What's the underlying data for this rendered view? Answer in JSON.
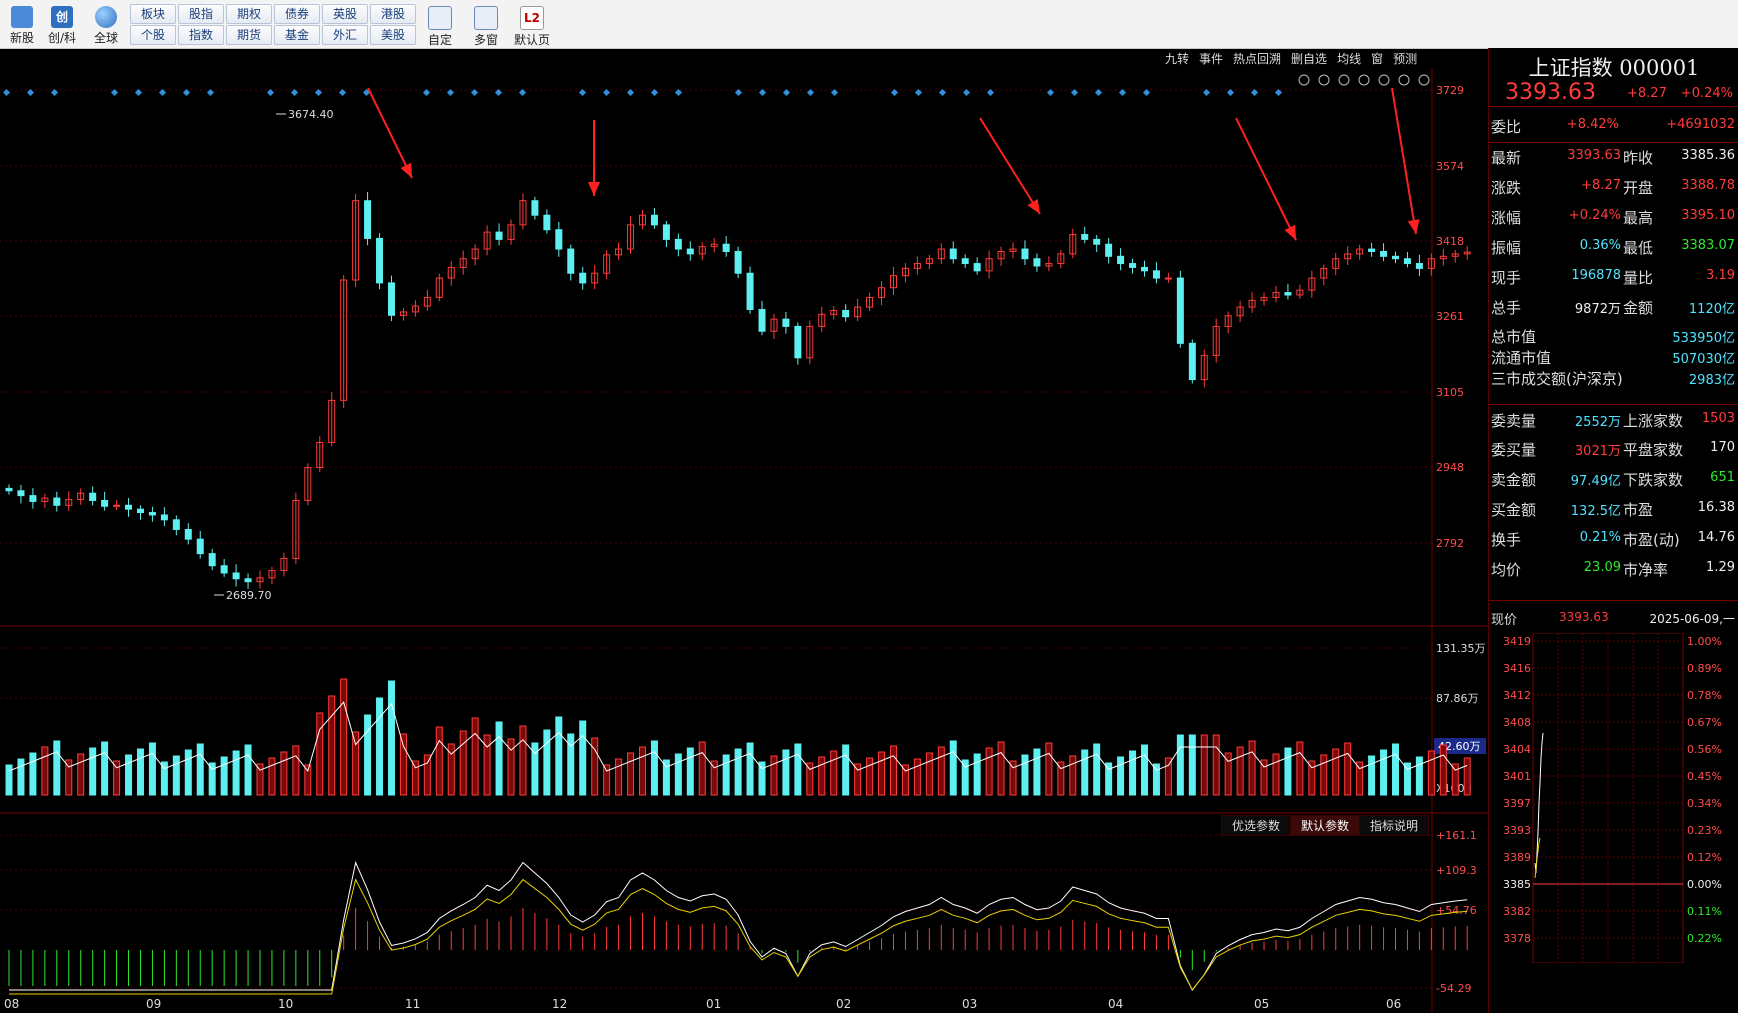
{
  "toolbar": {
    "big": [
      {
        "label": "新股",
        "icon": "doc-icon"
      },
      {
        "label": "创/科",
        "icon": "chuang-icon",
        "glyph": "创"
      },
      {
        "label": "全球",
        "icon": "globe-icon"
      },
      {
        "label": "自定",
        "icon": "custom-icon"
      },
      {
        "label": "多窗",
        "icon": "multiwindow-icon"
      },
      {
        "label": "默认页",
        "icon": "l2-icon",
        "glyph": "L2"
      }
    ],
    "grid": [
      [
        "板块",
        "股指",
        "期权",
        "债券",
        "英股",
        "港股"
      ],
      [
        "个股",
        "指数",
        "期货",
        "基金",
        "外汇",
        "美股"
      ]
    ]
  },
  "topbar": [
    "九转",
    "事件",
    "热点回溯",
    "删自选",
    "均线",
    "窗",
    "预测"
  ],
  "chart": {
    "annotations": [
      "3674.40",
      "2689.70"
    ],
    "price_axis": [
      "3729",
      "3574",
      "3418",
      "3261",
      "3105",
      "2948",
      "2792"
    ],
    "vol_axis": [
      "131.35万",
      "87.86万"
    ],
    "vol_current": "42.60万",
    "vol_unit": "X1000",
    "macd_axis": [
      "+161.1",
      "+109.3",
      "+54.76",
      "-54.29"
    ],
    "macd_tabs": [
      "优选参数",
      "默认参数",
      "指标说明"
    ],
    "months": [
      "08",
      "09",
      "10",
      "11",
      "12",
      "01",
      "02",
      "03",
      "04",
      "05",
      "06"
    ]
  },
  "chart_data": {
    "type": "candlestick",
    "ylim": [
      2600,
      3760
    ],
    "high_label": "3674.40",
    "low_label": "2689.70",
    "months": [
      "08",
      "09",
      "10",
      "11",
      "12",
      "01",
      "02",
      "03",
      "04",
      "05",
      "06"
    ],
    "close_series": [
      2900,
      2890,
      2878,
      2885,
      2870,
      2882,
      2895,
      2880,
      2868,
      2870,
      2862,
      2855,
      2850,
      2840,
      2820,
      2800,
      2770,
      2745,
      2730,
      2718,
      2712,
      2720,
      2735,
      2760,
      2880,
      2948,
      3000,
      3087,
      3336,
      3500,
      3422,
      3330,
      3263,
      3270,
      3282,
      3300,
      3340,
      3362,
      3380,
      3400,
      3435,
      3420,
      3450,
      3500,
      3470,
      3440,
      3400,
      3350,
      3330,
      3350,
      3388,
      3400,
      3450,
      3470,
      3450,
      3420,
      3400,
      3390,
      3405,
      3410,
      3395,
      3350,
      3275,
      3230,
      3255,
      3240,
      3175,
      3240,
      3265,
      3273,
      3260,
      3280,
      3300,
      3320,
      3345,
      3360,
      3370,
      3380,
      3400,
      3380,
      3370,
      3355,
      3380,
      3395,
      3400,
      3380,
      3365,
      3370,
      3390,
      3430,
      3420,
      3410,
      3385,
      3370,
      3362,
      3355,
      3340,
      3340,
      3205,
      3130,
      3180,
      3240,
      3262,
      3280,
      3294,
      3300,
      3310,
      3305,
      3315,
      3340,
      3360,
      3380,
      3390,
      3400,
      3395,
      3385,
      3380,
      3370,
      3360,
      3380,
      3385,
      3390,
      3393.63
    ],
    "macd_axis": [
      "+161.1",
      "+109.3",
      "+54.76",
      "-54.29"
    ]
  },
  "quote": {
    "title": "上证指数 000001",
    "price": "3393.63",
    "change": "+8.27",
    "change_pct": "+0.24%",
    "weibi_label": "委比",
    "weibi": "+8.42%",
    "weibi_diff": "+4691032",
    "rows": [
      {
        "l1": "最新",
        "v1": "3393.63",
        "c1": "red",
        "l2": "昨收",
        "v2": "3385.36",
        "c2": "wht"
      },
      {
        "l1": "涨跌",
        "v1": "+8.27",
        "c1": "red",
        "l2": "开盘",
        "v2": "3388.78",
        "c2": "red"
      },
      {
        "l1": "涨幅",
        "v1": "+0.24%",
        "c1": "red",
        "l2": "最高",
        "v2": "3395.10",
        "c2": "red"
      },
      {
        "l1": "振幅",
        "v1": "0.36%",
        "c1": "cyan",
        "l2": "最低",
        "v2": "3383.07",
        "c2": "grn"
      },
      {
        "l1": "现手",
        "v1": "196878",
        "c1": "cyan",
        "l2": "量比",
        "v2": "3.19",
        "c2": "red"
      },
      {
        "l1": "总手",
        "v1": "9872万",
        "c1": "wht",
        "l2": "金额",
        "v2": "1120亿",
        "c2": "cyan"
      }
    ],
    "mkt": [
      {
        "l": "总市值",
        "v": "533950亿"
      },
      {
        "l": "流通市值",
        "v": "507030亿"
      },
      {
        "l": "三市成交额(沪深京)",
        "v": "2983亿"
      }
    ],
    "rows2": [
      {
        "l1": "委卖量",
        "v1": "2552万",
        "c1": "cyan",
        "l2": "上涨家数",
        "v2": "1503",
        "c2": "red"
      },
      {
        "l1": "委买量",
        "v1": "3021万",
        "c1": "red",
        "l2": "平盘家数",
        "v2": "170",
        "c2": "wht"
      },
      {
        "l1": "卖金额",
        "v1": "97.49亿",
        "c1": "cyan",
        "l2": "下跌家数",
        "v2": "651",
        "c2": "grn"
      },
      {
        "l1": "买金额",
        "v1": "132.5亿",
        "c1": "cyan",
        "l2": "市盈",
        "v2": "16.38",
        "c2": "wht"
      },
      {
        "l1": "换手",
        "v1": "0.21%",
        "c1": "cyan",
        "l2": "市盈(动)",
        "v2": "14.76",
        "c2": "wht"
      },
      {
        "l1": "均价",
        "v1": "23.09",
        "c1": "grn",
        "l2": "市净率",
        "v2": "1.29",
        "c2": "wht"
      }
    ],
    "now_label": "现价",
    "now_value": "3393.63",
    "date": "2025-06-09,一"
  },
  "mini": {
    "left": [
      "3419",
      "3416",
      "3412",
      "3408",
      "3404",
      "3401",
      "3397",
      "3393",
      "3389",
      "3385",
      "3382",
      "3378"
    ],
    "right": [
      "1.00%",
      "0.89%",
      "0.78%",
      "0.67%",
      "0.56%",
      "0.45%",
      "0.34%",
      "0.23%",
      "0.12%",
      "0.00%",
      "0.11%",
      "0.22%"
    ]
  },
  "colors": {
    "up": "#ff3b3b",
    "down": "#5ef0f0",
    "grid": "#4a0000"
  }
}
